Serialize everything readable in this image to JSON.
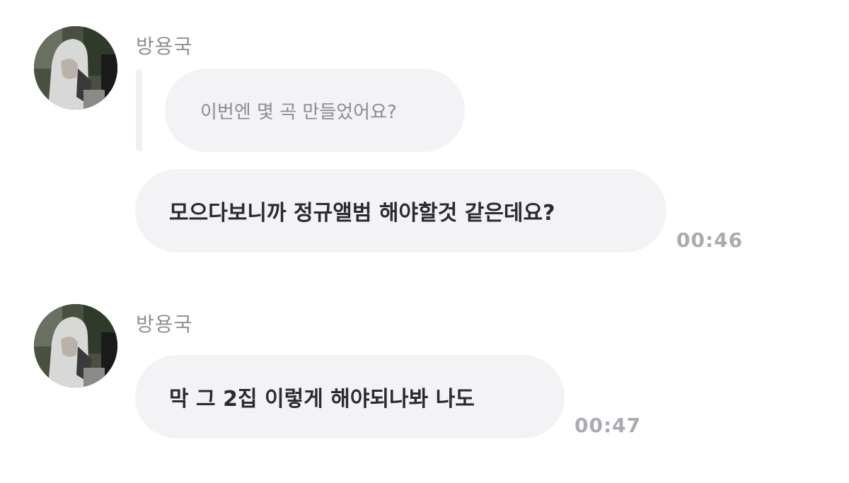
{
  "messages": [
    {
      "sender": "방용국",
      "avatar": "profile-photo",
      "quoted_text": "이번엔 몇 곡 만들었어요?",
      "text": "모으다보니까 정규앨범 해야할것 같은데요?",
      "time": "00:46"
    },
    {
      "sender": "방용국",
      "avatar": "profile-photo",
      "text": "막 그 2집 이렇게 해야되나봐 나도",
      "time": "00:47"
    }
  ],
  "colors": {
    "bubble": "#f3f3f6",
    "sender_text": "#8f9096",
    "time_text": "#a9abb0",
    "message_text": "#2a2b2f",
    "quoted_text": "#8b8c92"
  }
}
